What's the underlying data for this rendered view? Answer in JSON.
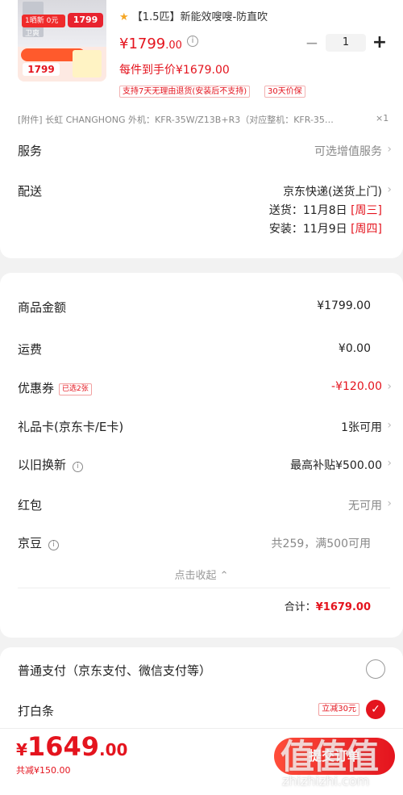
{
  "product": {
    "thumb_tag": "1晒新 0元卫爽",
    "thumb_badge": "1799",
    "thumb_price": "1799",
    "star_icon": "★",
    "title": "【1.5匹】新能效嗖嗖-防直吹",
    "price_main": "¥1799",
    "price_decimal": ".00",
    "unit_price": "每件到手价¥1679.00",
    "quantity": "1",
    "policy_return": "支持7天无理由退货(安装后不支持)",
    "policy_price": "30天价保",
    "accessory": "[附件]  长虹 CHANGHONG 外机：KFR-35W/Z13B+R3（对应整机：KFR-35…",
    "accessory_qty": "×1"
  },
  "service": {
    "label": "服务",
    "value": "可选增值服务"
  },
  "delivery": {
    "label": "配送",
    "method": "京东快递(送货上门)",
    "ship_label": "送货：11月8日",
    "ship_day": "[周三]",
    "install_label": "安装：11月9日",
    "install_day": "[周四]"
  },
  "summary": {
    "goods_label": "商品金额",
    "goods_value": "¥1799.00",
    "freight_label": "运费",
    "freight_value": "¥0.00",
    "coupon_label": "优惠券",
    "coupon_badge": "已选2张",
    "coupon_value": "-¥120.00",
    "giftcard_label": "礼品卡(京东卡/E卡)",
    "giftcard_value": "1张可用",
    "tradein_label": "以旧换新",
    "tradein_value": "最高补贴¥500.00",
    "redpacket_label": "红包",
    "redpacket_value": "无可用",
    "beans_label": "京豆",
    "beans_value": "共259，满500可用",
    "collapse": "点击收起 ⌃",
    "total_label": "合计：",
    "total_value": "¥1679.00"
  },
  "payment": {
    "normal_label": "普通支付（京东支付、微信支付等）",
    "baitiao_label": "打白条",
    "baitiao_promo": "立减30元"
  },
  "bottom": {
    "price_symbol": "¥",
    "price_int": "1649",
    "price_dec": ".00",
    "saved": "共减¥150.00",
    "submit": "提交订单",
    "watermark": "值值值",
    "watermark_url": "zhizhizhi.com"
  },
  "colors": {
    "accent": "#e4141e",
    "accent_light": "#ff4d3a",
    "bg": "#f2f2f2"
  }
}
